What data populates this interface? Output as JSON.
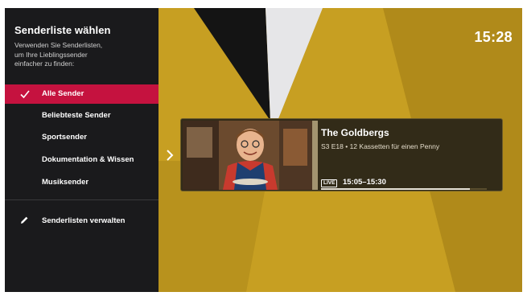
{
  "sidebar": {
    "title": "Senderliste wählen",
    "description": "Verwenden Sie Senderlisten,\num Ihre Lieblingssender\neinfacher zu finden:",
    "items": [
      {
        "label": "Alle Sender",
        "selected": true
      },
      {
        "label": "Beliebteste Sender",
        "selected": false
      },
      {
        "label": "Sportsender",
        "selected": false
      },
      {
        "label": "Dokumentation & Wissen",
        "selected": false
      },
      {
        "label": "Musiksender",
        "selected": false
      }
    ],
    "manage_label": "Senderlisten verwalten",
    "selected_color": "#c5123f"
  },
  "clock": "15:28",
  "program": {
    "title": "The Goldbergs",
    "episode": "S3 E18 • 12 Kassetten für einen Penny",
    "live_badge": "LIVE",
    "time": "15:05–15:30",
    "progress": 0.9
  },
  "icons": {
    "check": "check-icon",
    "pencil": "pencil-icon",
    "arrow": "chevron-right-icon"
  },
  "colors": {
    "sidebar_bg": "#1a1a1c",
    "backdrop_yellow": "#c79f22",
    "card_bg": "#322b18"
  }
}
